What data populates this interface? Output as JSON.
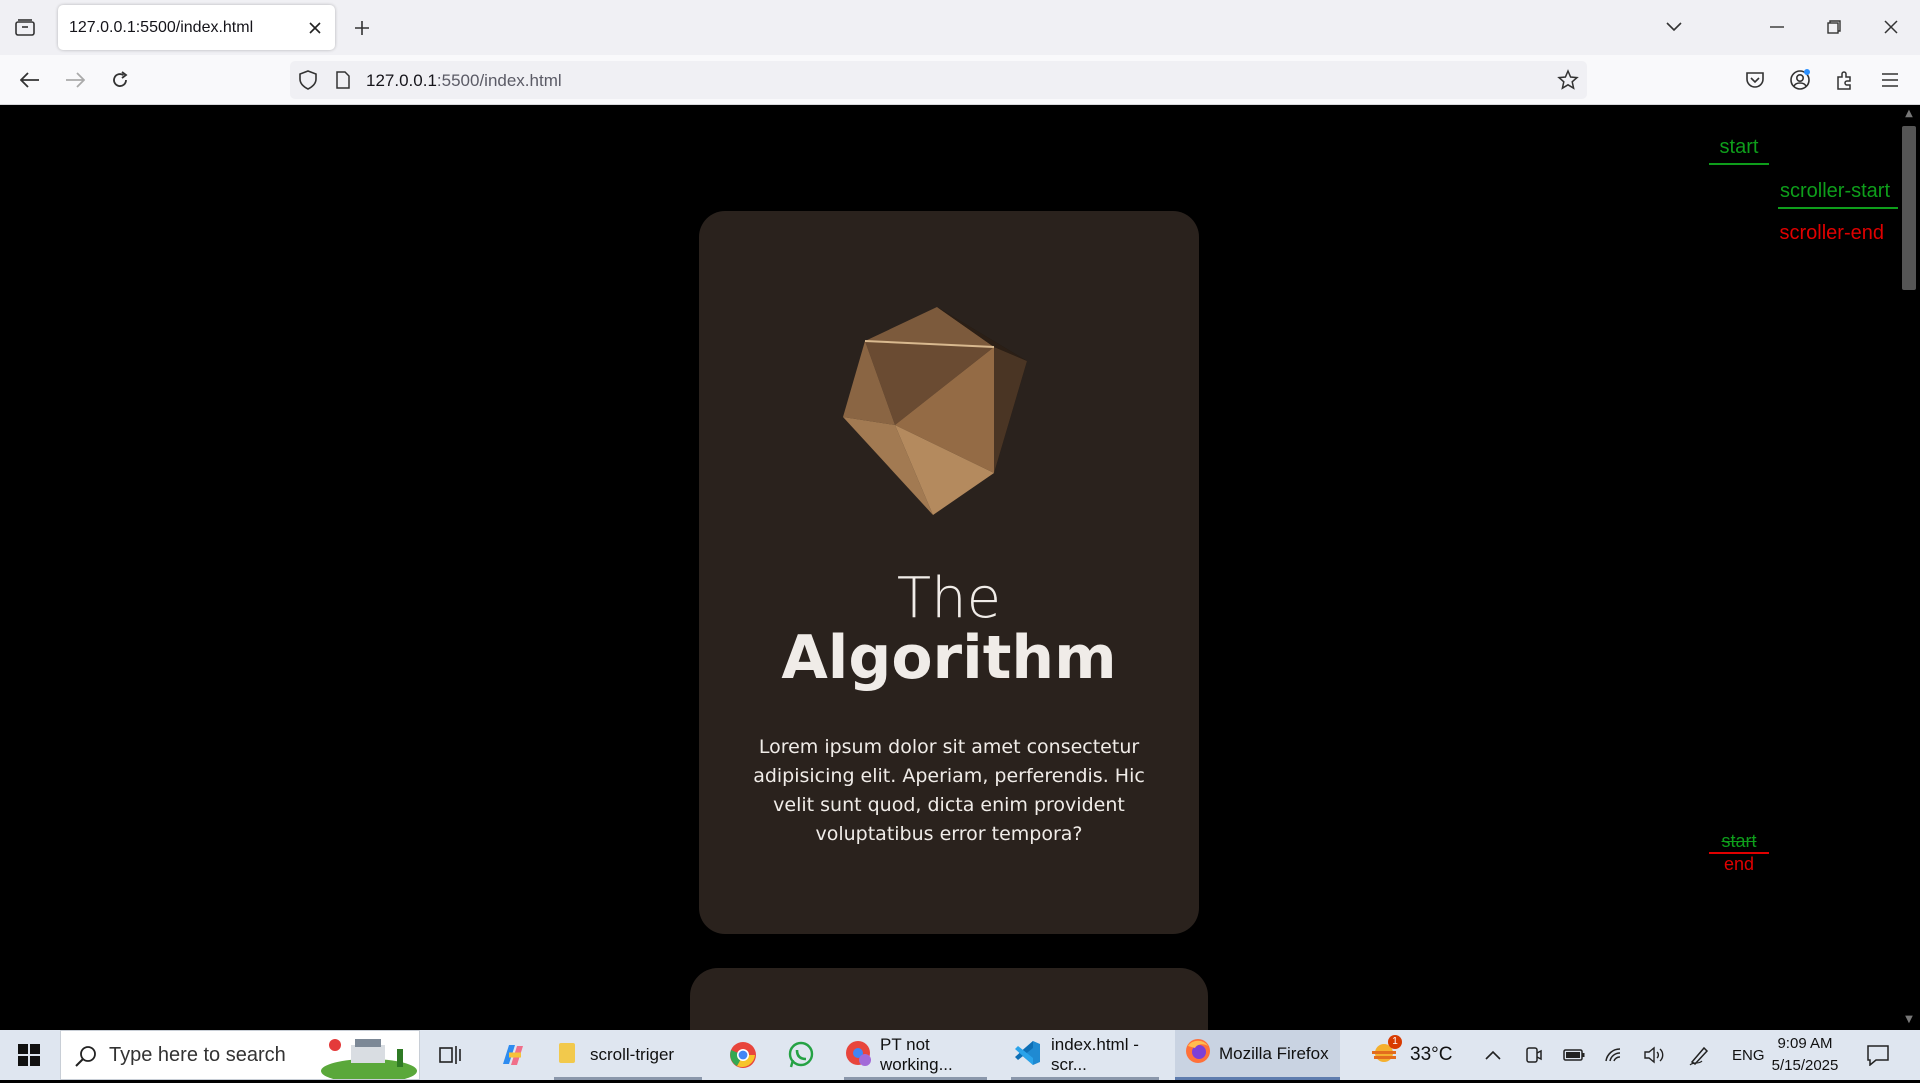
{
  "browser": {
    "tab_title": "127.0.0.1:5500/index.html",
    "url_host": "127.0.0.1",
    "url_rest": ":5500/index.html"
  },
  "page": {
    "card": {
      "title_light": "The",
      "title_bold": "Algorithm",
      "body": "Lorem ipsum dolor sit amet consectetur adipisicing elit. Aperiam, perferendis. Hic velit sunt quod, dicta enim provident voluptatibus error tempora?"
    },
    "markers": {
      "start": "start",
      "scroller_start": "scroller-start",
      "scroller_end": "scroller-end",
      "start_bottom": "start",
      "end_bottom": "end"
    }
  },
  "taskbar": {
    "search_placeholder": "Type here to search",
    "items": [
      {
        "label": "scroll-triger"
      },
      {
        "label": "PT not working..."
      },
      {
        "label": "index.html - scr..."
      },
      {
        "label": "Mozilla Firefox"
      }
    ],
    "weather": "33°C",
    "weather_badge": "1",
    "language": "ENG",
    "time": "9:09 AM",
    "date": "5/15/2025"
  },
  "colors": {
    "card_bg": "#2a221d",
    "marker_green": "#0e9e1b",
    "marker_red": "#e00000"
  }
}
